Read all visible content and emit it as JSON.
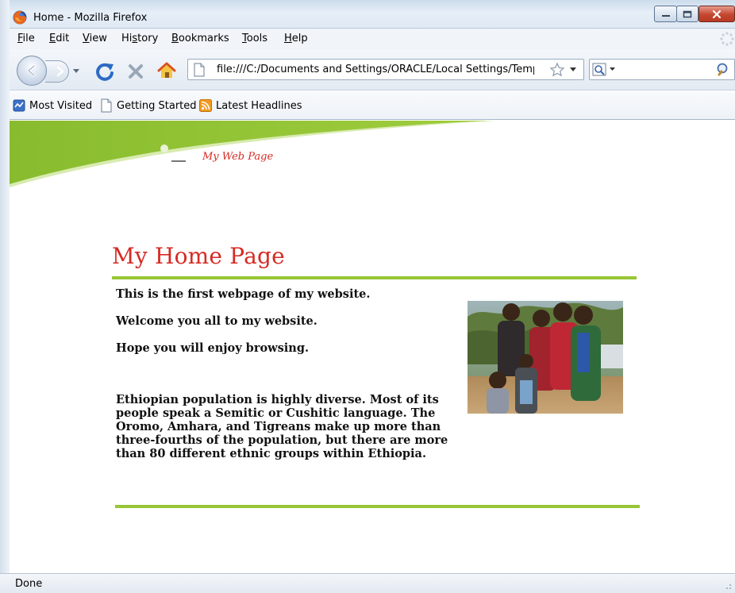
{
  "window": {
    "title": "Home - Mozilla Firefox"
  },
  "menu": [
    {
      "pre": "",
      "key": "F",
      "post": "ile"
    },
    {
      "pre": "",
      "key": "E",
      "post": "dit"
    },
    {
      "pre": "",
      "key": "V",
      "post": "iew"
    },
    {
      "pre": "Hi",
      "key": "s",
      "post": "tory"
    },
    {
      "pre": "",
      "key": "B",
      "post": "ookmarks"
    },
    {
      "pre": "",
      "key": "T",
      "post": "ools"
    },
    {
      "pre": "",
      "key": "H",
      "post": "elp"
    }
  ],
  "address": {
    "url": "file:///C:/Documents and Settings/ORACLE/Local Settings/Tempc"
  },
  "search": {
    "value": ""
  },
  "bookmarks": [
    {
      "label": "Most Visited",
      "icon": "most-visited-icon"
    },
    {
      "label": "Getting Started",
      "icon": "page-icon"
    },
    {
      "label": "Latest Headlines",
      "icon": "rss-feed-icon"
    }
  ],
  "page": {
    "tagline": "My Web Page",
    "title": "My Home Page",
    "paragraphs": [
      "This  is the first webpage of my website.",
      "Welcome you all to  my website.",
      "Hope you will enjoy browsing.",
      "Ethiopian population is highly diverse. Most of its people speak a Semitic or Cushitic language. The Oromo, Amhara, and Tigreans make up more than three-fourths of the population, but there are more than 80 different ethnic groups within Ethiopia."
    ],
    "photo": "group-photo"
  },
  "status": {
    "text": "Done"
  },
  "colors": {
    "accent_green": "#98c637",
    "title_red": "#d62a24"
  }
}
